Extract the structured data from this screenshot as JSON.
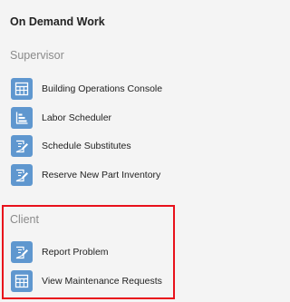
{
  "page": {
    "title": "On Demand Work"
  },
  "sections": [
    {
      "header": "Supervisor",
      "items": [
        {
          "label": "Building Operations Console",
          "icon": "grid-table-icon"
        },
        {
          "label": "Labor Scheduler",
          "icon": "bar-chart-icon"
        },
        {
          "label": "Schedule Substitutes",
          "icon": "edit-form-icon"
        },
        {
          "label": "Reserve New Part Inventory",
          "icon": "edit-form-icon"
        }
      ]
    },
    {
      "header": "Client",
      "highlighted": true,
      "highlight_color": "#e8111b",
      "items": [
        {
          "label": "Report Problem",
          "icon": "edit-form-icon"
        },
        {
          "label": "View Maintenance Requests",
          "icon": "grid-table-icon"
        }
      ]
    }
  ],
  "colors": {
    "tile": "#5f97cf",
    "section_header": "#8a8a8a",
    "background": "#f4f4f4"
  }
}
